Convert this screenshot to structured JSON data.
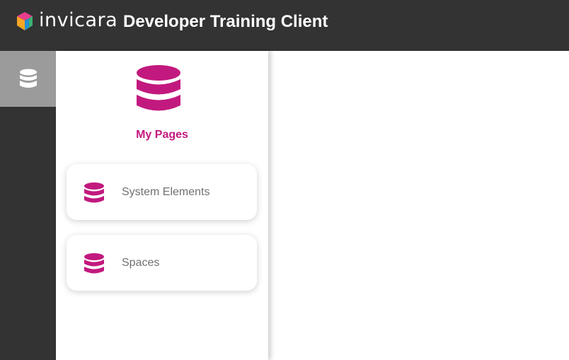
{
  "header": {
    "logo_text": "invicara",
    "app_title": "Developer Training Client"
  },
  "rail": {
    "items": [
      {
        "icon": "database-icon",
        "active": true
      }
    ]
  },
  "panel": {
    "title": "My Pages",
    "icon": "database-icon",
    "items": [
      {
        "label": "System Elements",
        "icon": "database-icon"
      },
      {
        "label": "Spaces",
        "icon": "database-icon"
      }
    ]
  },
  "colors": {
    "header_bg": "#333333",
    "rail_active_bg": "#9b9b9b",
    "accent": "#c2197e",
    "card_text": "#707070"
  }
}
